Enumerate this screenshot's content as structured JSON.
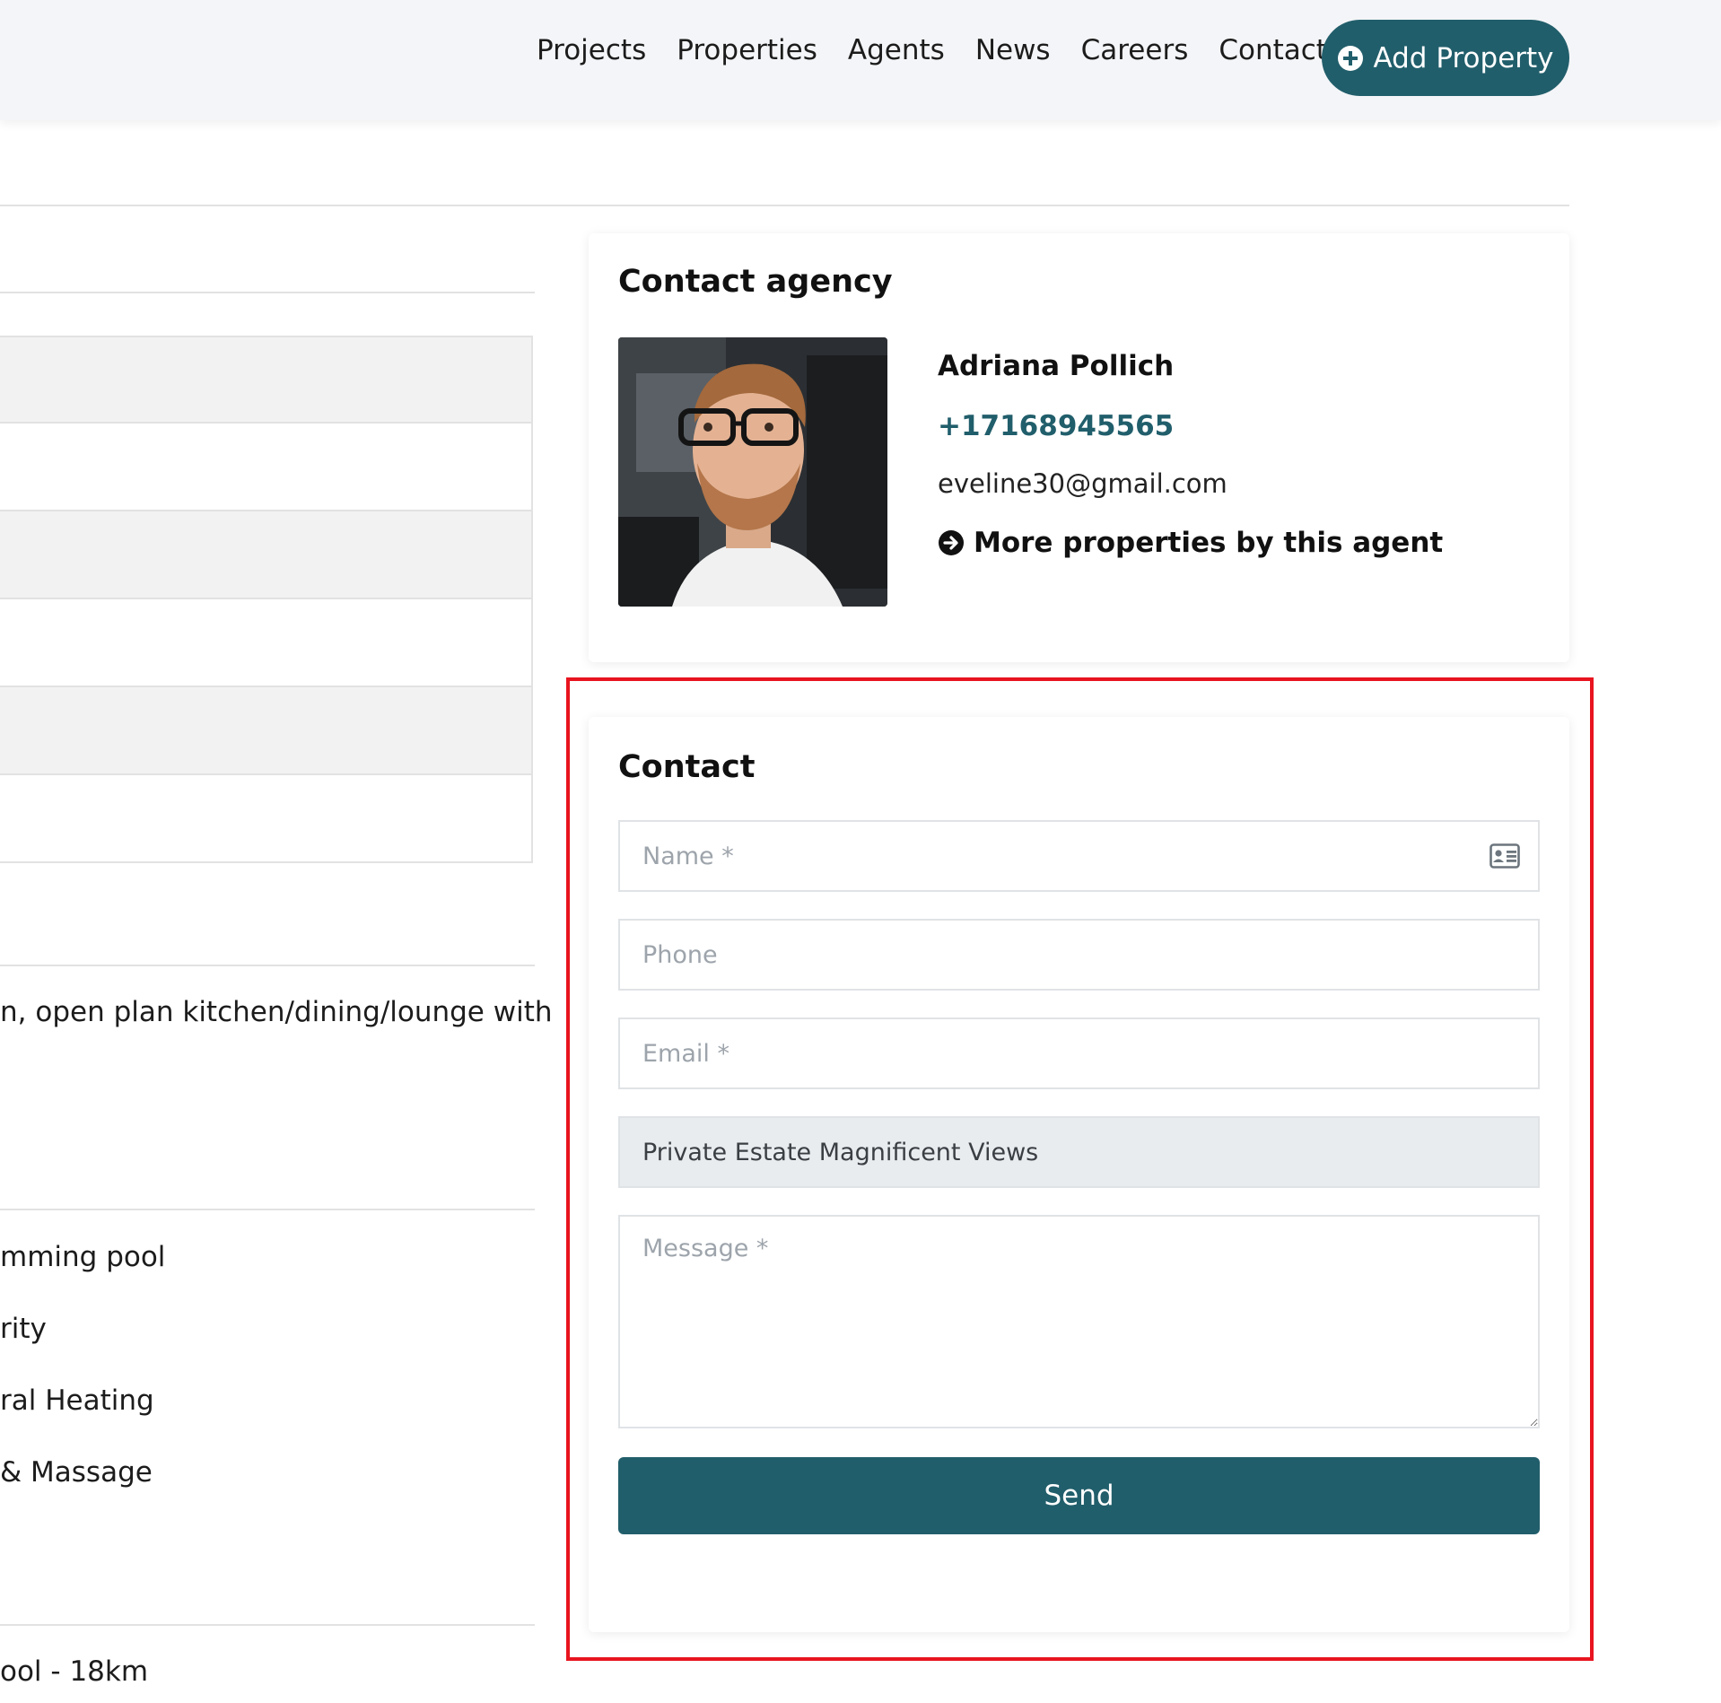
{
  "nav": {
    "items": [
      "Projects",
      "Properties",
      "Agents",
      "News",
      "Careers",
      "Contact"
    ],
    "add_property_label": "Add Property"
  },
  "left": {
    "description_fragment": "n, open plan kitchen/dining/lounge with",
    "features": [
      "mming pool",
      "rity",
      "ral Heating",
      "& Massage"
    ],
    "distance_fragment": "ool - 18km"
  },
  "agency_card": {
    "title": "Contact agency",
    "agent_name": "Adriana Pollich",
    "agent_phone": "+17168945565",
    "agent_email": "eveline30@gmail.com",
    "more_label": "More properties by this agent"
  },
  "contact_form": {
    "title": "Contact",
    "name_placeholder": "Name *",
    "phone_placeholder": "Phone",
    "email_placeholder": "Email *",
    "property_value": "Private Estate Magnificent Views",
    "message_placeholder": "Message *",
    "send_label": "Send"
  },
  "colors": {
    "brand": "#215e6b",
    "highlight": "#e8141f"
  }
}
